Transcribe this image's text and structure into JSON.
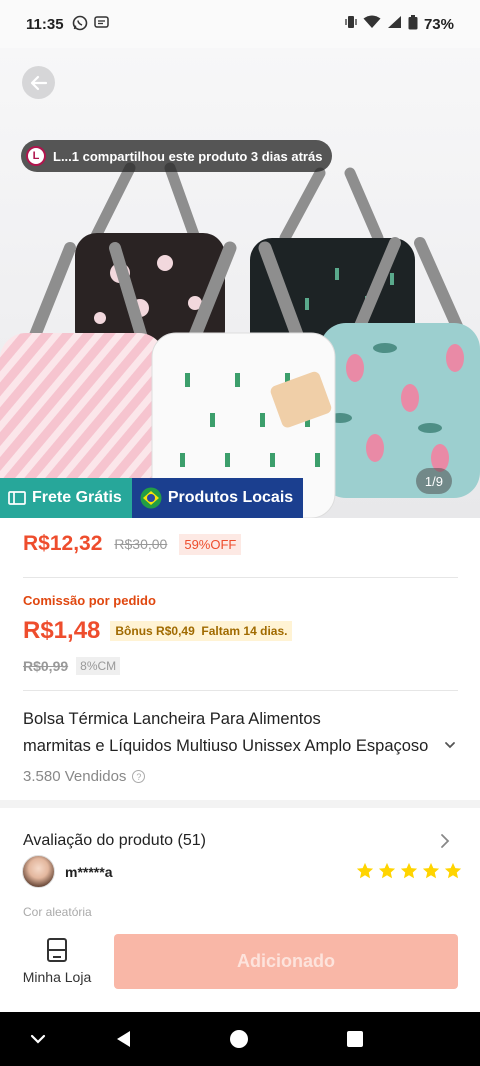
{
  "status_bar": {
    "time": "11:35",
    "battery": "73%"
  },
  "hero": {
    "share_avatar_letter": "L",
    "share_text": "L...1 compartilhou este produto 3 dias atrás",
    "image_counter": "1/9",
    "badge_frete": "Frete Grátis",
    "badge_local": "Produtos Locais"
  },
  "price": {
    "current": "R$12,32",
    "original": "R$30,00",
    "discount": "59%OFF"
  },
  "commission": {
    "label": "Comissão por pedido",
    "value": "R$1,48",
    "bonus": "Bônus R$0,49",
    "deadline": "Faltam 14 dias.",
    "old_value": "R$0,99",
    "cm": "8%CM"
  },
  "product": {
    "title_line1": "Bolsa Térmica Lancheira Para Alimentos",
    "title_line2": "marmitas e Líquidos Multiuso Unissex Amplo Espaçoso",
    "sold": "3.580 Vendidos"
  },
  "review": {
    "title": "Avaliação do produto (51)",
    "reviewer": "m*****a",
    "rating": 5,
    "variation": "Cor aleatória"
  },
  "bottom": {
    "shop_label": "Minha Loja",
    "add_label": "Adicionado"
  },
  "colors": {
    "accent": "#ee4d2d",
    "frete": "#27a79a",
    "local": "#1b3f8f",
    "star": "#ffd400",
    "add_button": "#f9b7a7"
  },
  "icons": [
    "whatsapp-icon",
    "message-icon",
    "vibrate-icon",
    "wifi-icon",
    "signal-icon",
    "battery-icon",
    "back-arrow-icon",
    "truck-icon",
    "brazil-flag-icon",
    "help-icon",
    "chevron-down-icon",
    "chevron-right-icon",
    "star-icon",
    "shop-icon",
    "nav-back-icon",
    "nav-home-icon",
    "nav-recents-icon",
    "nav-collapse-icon"
  ]
}
